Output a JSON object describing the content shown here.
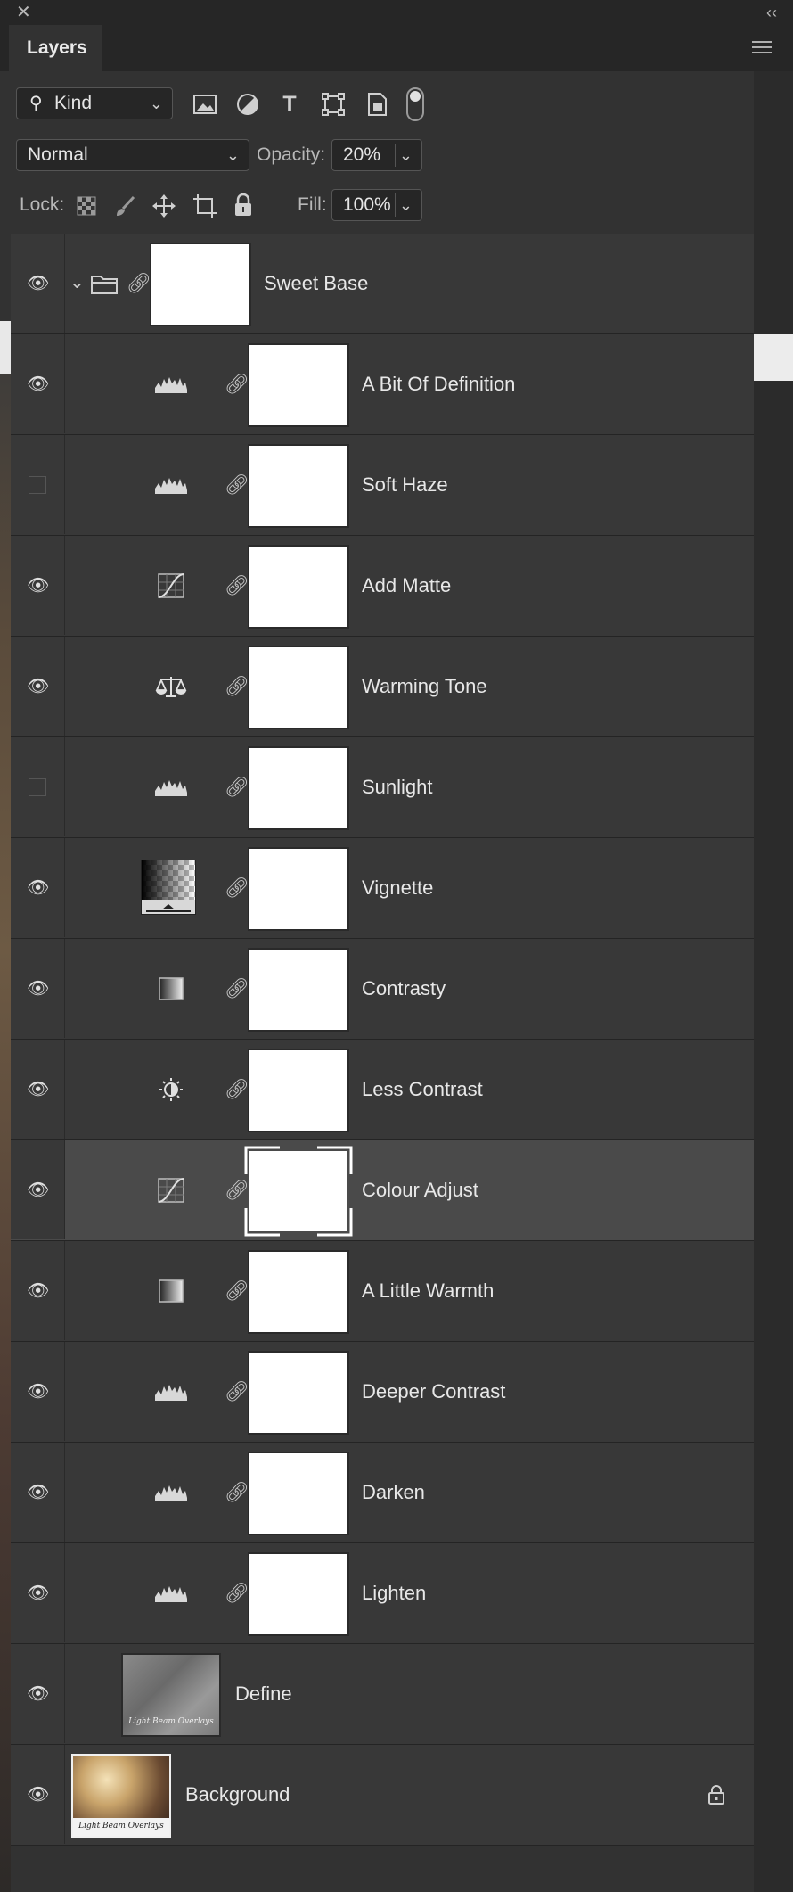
{
  "panel": {
    "close_glyph": "✕",
    "collapse_glyph": "‹‹",
    "tab_label": "Layers",
    "menu_icon": "hamburger-menu-icon"
  },
  "filter": {
    "kind_value": "Kind",
    "icons": [
      "image-filter-icon",
      "adjustment-filter-icon",
      "type-filter-icon",
      "shape-filter-icon",
      "smart-object-filter-icon",
      "filter-toggle-icon"
    ]
  },
  "blend": {
    "mode_value": "Normal",
    "opacity_label": "Opacity:",
    "opacity_value": "20%"
  },
  "lock": {
    "label": "Lock:",
    "icons": [
      "lock-transparent-pixels-icon",
      "lock-image-pixels-icon",
      "lock-position-icon",
      "lock-artboard-icon",
      "lock-all-icon"
    ],
    "fill_label": "Fill:",
    "fill_value": "100%"
  },
  "layers": [
    {
      "name": "Sweet Base",
      "visible": true,
      "type": "group"
    },
    {
      "name": "A Bit Of Definition",
      "visible": true,
      "type": "levels"
    },
    {
      "name": "Soft Haze",
      "visible": false,
      "type": "levels"
    },
    {
      "name": "Add Matte",
      "visible": true,
      "type": "curves"
    },
    {
      "name": "Warming Tone",
      "visible": true,
      "type": "color-balance"
    },
    {
      "name": "Sunlight",
      "visible": false,
      "type": "levels"
    },
    {
      "name": "Vignette",
      "visible": true,
      "type": "gradient-fill"
    },
    {
      "name": "Contrasty",
      "visible": true,
      "type": "gradient-map"
    },
    {
      "name": "Less Contrast",
      "visible": true,
      "type": "brightness-contrast"
    },
    {
      "name": "Colour Adjust",
      "visible": true,
      "type": "curves",
      "selected": true
    },
    {
      "name": "A Little Warmth",
      "visible": true,
      "type": "gradient-map"
    },
    {
      "name": "Deeper Contrast",
      "visible": true,
      "type": "levels"
    },
    {
      "name": "Darken",
      "visible": true,
      "type": "levels"
    },
    {
      "name": "Lighten",
      "visible": true,
      "type": "levels"
    },
    {
      "name": "Define",
      "visible": true,
      "type": "pixel"
    },
    {
      "name": "Background",
      "visible": true,
      "type": "background",
      "locked": true
    }
  ],
  "thumbnail_text": "Light Beam Overlays",
  "colors": {
    "panel": "#323232",
    "row": "#383838",
    "selected_row": "#4a4a4a",
    "mask": "#ffffff"
  }
}
